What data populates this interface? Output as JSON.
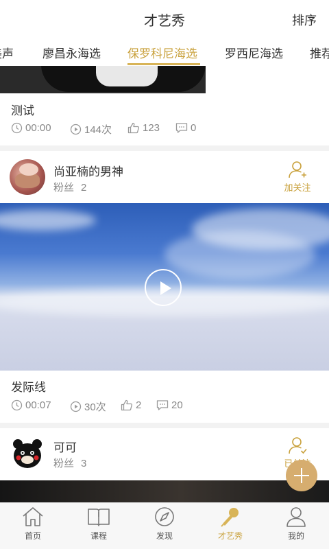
{
  "header": {
    "title": "才艺秀",
    "sort_label": "排序"
  },
  "tabs": [
    {
      "label": "美声"
    },
    {
      "label": "廖昌永海选"
    },
    {
      "label": "保罗科尼海选",
      "active": true
    },
    {
      "label": "罗西尼海选"
    },
    {
      "label": "推荐"
    }
  ],
  "posts": [
    {
      "title": "测试",
      "duration": "00:00",
      "plays": "144次",
      "likes": "123",
      "comments": "0"
    },
    {
      "user": {
        "name": "尚亚楠的男神",
        "fans_label": "粉丝",
        "fans_count": "2",
        "follow_label": "加关注"
      },
      "title": "发际线",
      "duration": "00:07",
      "plays": "30次",
      "likes": "2",
      "comments": "20"
    },
    {
      "user": {
        "name": "可可",
        "fans_label": "粉丝",
        "fans_count": "3",
        "follow_label": "已关注"
      }
    }
  ],
  "tabbar": [
    {
      "label": "首页",
      "icon": "home-icon"
    },
    {
      "label": "课程",
      "icon": "book-icon"
    },
    {
      "label": "发现",
      "icon": "compass-icon"
    },
    {
      "label": "才艺秀",
      "icon": "microphone-icon",
      "active": true
    },
    {
      "label": "我的",
      "icon": "profile-icon"
    }
  ],
  "colors": {
    "accent": "#c9a13c",
    "fab": "#d6ad6f"
  }
}
